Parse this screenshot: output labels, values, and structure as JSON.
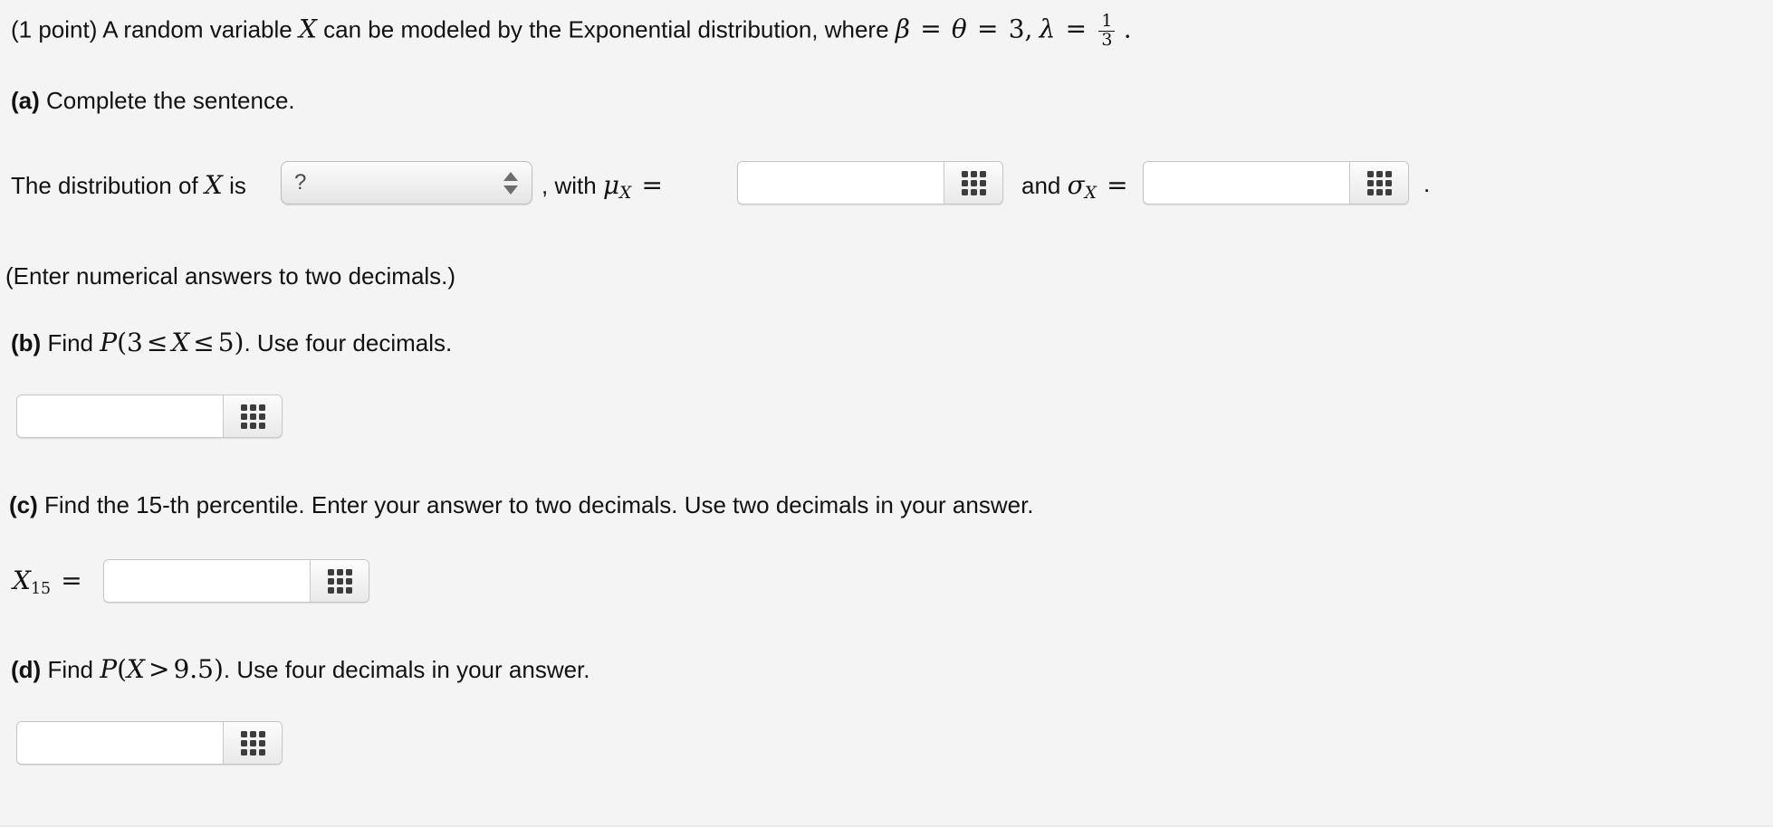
{
  "problem": {
    "points_label": "(1 point)",
    "intro_text_1": "A random variable",
    "intro_var": "X",
    "intro_text_2": "can be modeled by the Exponential distribution, where",
    "beta_symbol": "β",
    "eq1": "=",
    "theta_symbol": "θ",
    "eq2": "=",
    "value_3": "3,",
    "lambda_symbol": "λ",
    "eq3": "=",
    "lambda_num": "1",
    "lambda_den": "3",
    "period": "."
  },
  "part_a": {
    "label": "(a)",
    "text": "Complete the sentence.",
    "sentence_prefix": "The distribution of",
    "sentence_var": "X",
    "sentence_is": "is",
    "dropdown": {
      "selected": "?",
      "options": [
        "?"
      ],
      "name": "distribution-type-select"
    },
    "comma_with": ", with",
    "mu_symbol": "μ",
    "mu_sub": "X",
    "mu_eq": "=",
    "mu_input_value": "",
    "and_label": "and",
    "sigma_symbol": "σ",
    "sigma_sub": "X",
    "sigma_eq": "=",
    "sigma_input_value": "",
    "trailing_period": ".",
    "note": "(Enter numerical answers to two decimals.)"
  },
  "part_b": {
    "label": "(b)",
    "find_word": "Find",
    "prob_p": "P",
    "prob_open": "(3",
    "prob_le1": "≤",
    "prob_var": "X",
    "prob_le2": "≤",
    "prob_close": "5)",
    "tail_text": ". Use four decimals.",
    "input_value": ""
  },
  "part_c": {
    "label": "(c)",
    "text": "Find the 15-th percentile. Enter your answer to two decimals. Use two decimals in your answer.",
    "var_symbol": "X",
    "var_sub": "15",
    "var_eq": "=",
    "input_value": ""
  },
  "part_d": {
    "label": "(d)",
    "find_word": "Find",
    "prob_p": "P",
    "prob_open": "(",
    "prob_var": "X",
    "prob_gt": ">",
    "prob_close": "9.5)",
    "tail_text": ". Use four decimals in your answer.",
    "input_value": ""
  },
  "icons": {
    "keypad": "keypad-grid-icon",
    "stepper_up": "stepper-up-arrow-icon",
    "stepper_down": "stepper-down-arrow-icon"
  },
  "colors": {
    "background": "#f4f4f4",
    "text": "#121212",
    "field_border": "#c6c6c6",
    "field_bg": "#ffffff",
    "icon_dot": "#3d3d3d"
  }
}
